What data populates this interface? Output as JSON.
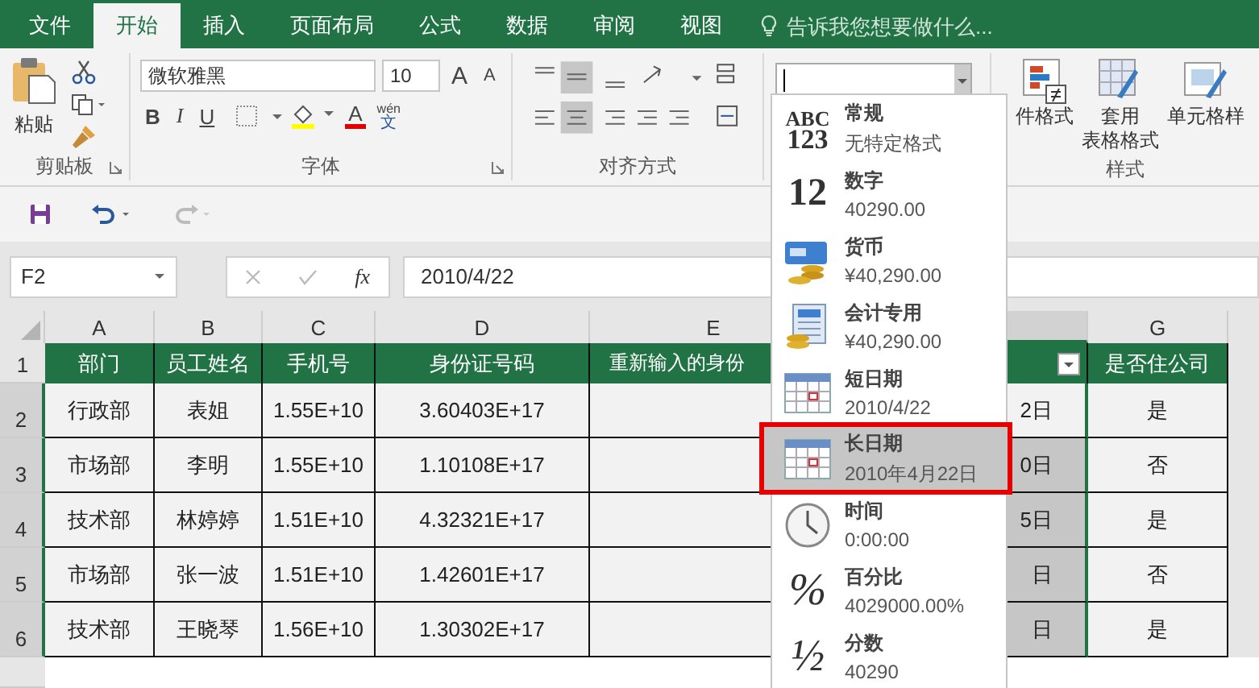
{
  "ribbon_tabs": [
    {
      "label": "文件",
      "selected": false
    },
    {
      "label": "开始",
      "selected": true
    },
    {
      "label": "插入",
      "selected": false
    },
    {
      "label": "页面布局",
      "selected": false
    },
    {
      "label": "公式",
      "selected": false
    },
    {
      "label": "数据",
      "selected": false
    },
    {
      "label": "审阅",
      "selected": false
    },
    {
      "label": "视图",
      "selected": false
    }
  ],
  "tell_me": {
    "placeholder": "告诉我您想要做什么..."
  },
  "clipboard": {
    "paste_label": "粘贴",
    "group_label": "剪贴板"
  },
  "font": {
    "name": "微软雅黑",
    "size": "10",
    "grow": "A",
    "shrink": "A",
    "bold": "B",
    "italic": "I",
    "underline": "U",
    "font_color": "A",
    "phonetic": "wén",
    "phonetic_char": "文",
    "group_label": "字体"
  },
  "alignment": {
    "group_label": "对齐方式"
  },
  "styles": {
    "group_label": "样式",
    "buttons": [
      {
        "kind": "conditional",
        "lines": [
          "件格式"
        ]
      },
      {
        "kind": "table",
        "lines": [
          "套用",
          "表格格式"
        ]
      },
      {
        "kind": "cell",
        "lines": [
          "单元格样"
        ]
      }
    ]
  },
  "formula_bar": {
    "name_box": "F2",
    "fx": "fx",
    "formula": "2010/4/22"
  },
  "columns": [
    {
      "letter": "A",
      "selected": false
    },
    {
      "letter": "B",
      "selected": false
    },
    {
      "letter": "C",
      "selected": false
    },
    {
      "letter": "D",
      "selected": false
    },
    {
      "letter": "E",
      "selected": false
    },
    {
      "selected": true
    },
    {
      "letter": "G",
      "selected": false
    }
  ],
  "table": {
    "header_row": "1",
    "header": {
      "dept": "部门",
      "name": "员工姓名",
      "phone": "手机号",
      "id": "身份证号码",
      "reentered_id": "重新输入的身份",
      "filter": true,
      "resident": "是否住公司"
    },
    "rows": [
      {
        "row": "2",
        "selected": true,
        "dept": "行政部",
        "name": "表姐",
        "phone": "1.55E+10",
        "id": "3.60403E+17",
        "col_f": "2日",
        "active": true,
        "resident": "是"
      },
      {
        "row": "3",
        "selected": true,
        "dept": "市场部",
        "name": "李明",
        "phone": "1.55E+10",
        "id": "1.10108E+17",
        "col_f": "0日",
        "active": false,
        "resident": "否"
      },
      {
        "row": "4",
        "selected": true,
        "dept": "技术部",
        "name": "林婷婷",
        "phone": "1.51E+10",
        "id": "4.32321E+17",
        "col_f": "5日",
        "active": false,
        "resident": "是"
      },
      {
        "row": "5",
        "selected": true,
        "dept": "市场部",
        "name": "张一波",
        "phone": "1.51E+10",
        "id": "1.42601E+17",
        "col_f": "日",
        "active": false,
        "resident": "否"
      },
      {
        "row": "6",
        "selected": true,
        "dept": "技术部",
        "name": "王晓琴",
        "phone": "1.56E+10",
        "id": "1.30302E+17",
        "col_f": "日",
        "active": false,
        "resident": "是"
      }
    ]
  },
  "format_menu": {
    "items": [
      {
        "kind": "general",
        "glyph": [
          "ABC",
          "123"
        ],
        "title": "常规",
        "sample": "无特定格式",
        "selected": false
      },
      {
        "kind": "number",
        "glyph": [
          "12"
        ],
        "title": "数字",
        "sample": "40290.00",
        "selected": false
      },
      {
        "kind": "currency",
        "title": "货币",
        "sample": "¥40,290.00",
        "selected": false
      },
      {
        "kind": "accounting",
        "title": "会计专用",
        "sample": "¥40,290.00",
        "selected": false
      },
      {
        "kind": "short_date",
        "title": "短日期",
        "sample": "2010/4/22",
        "selected": false
      },
      {
        "kind": "long_date",
        "title": "长日期",
        "sample": "2010年4月22日",
        "selected": true
      },
      {
        "kind": "time",
        "title": "时间",
        "sample": "0:00:00",
        "selected": false
      },
      {
        "kind": "percent",
        "glyph": [
          "%"
        ],
        "title": "百分比",
        "sample": "4029000.00%",
        "selected": false
      },
      {
        "kind": "fraction",
        "glyph": [
          "½"
        ],
        "title": "分数",
        "sample": "40290",
        "selected": false
      }
    ]
  }
}
